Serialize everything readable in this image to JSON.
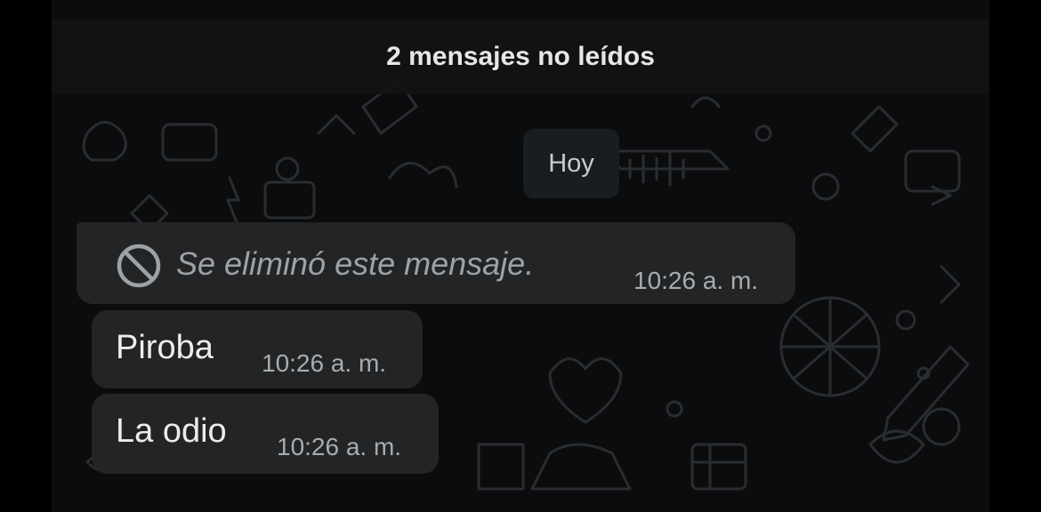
{
  "banner": {
    "unread_label": "2 mensajes no leídos"
  },
  "date_chip": {
    "label": "Hoy"
  },
  "messages": [
    {
      "text": "Se eliminó este mensaje.",
      "time": "10:26 a. m.",
      "deleted": true,
      "icon": "ban-icon"
    },
    {
      "text": "Piroba",
      "time": "10:26 a. m.",
      "deleted": false
    },
    {
      "text": "La odio",
      "time": "10:26 a. m.",
      "deleted": false
    }
  ],
  "colors": {
    "background": "#0b0c0d",
    "bubble": "#222426",
    "banner": "#111315",
    "text": "#ececec",
    "muted": "#a9acae"
  }
}
